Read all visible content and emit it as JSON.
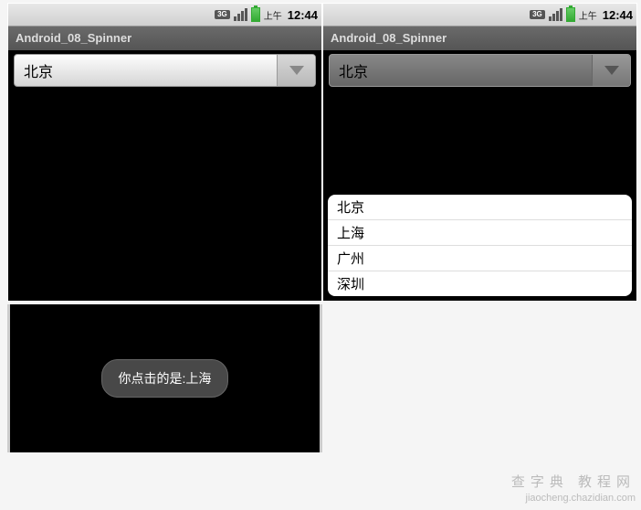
{
  "status": {
    "network_label": "3G",
    "ampm": "上午",
    "time": "12:44"
  },
  "app": {
    "title": "Android_08_Spinner"
  },
  "spinner": {
    "selected": "北京",
    "options": [
      "北京",
      "上海",
      "广州",
      "深圳"
    ]
  },
  "toast": {
    "message": "你点击的是:上海"
  },
  "watermark": {
    "chinese": "查字典 教程网",
    "url": "jiaocheng.chazidian.com"
  }
}
